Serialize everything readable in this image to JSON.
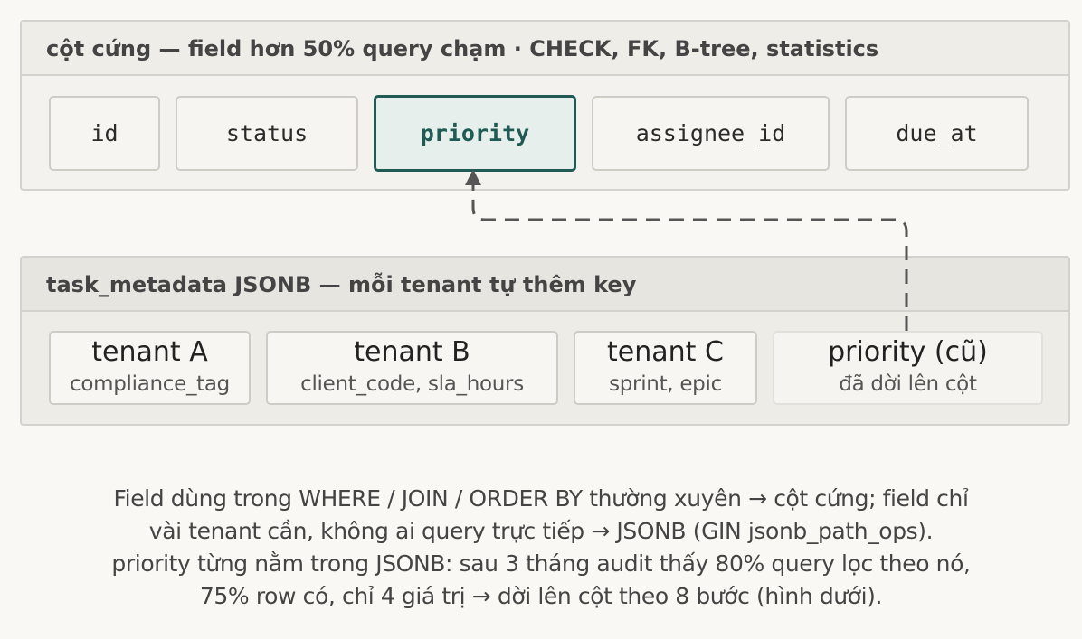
{
  "columns_panel": {
    "title": "cột cứng — field hơn 50% query chạm · CHECK, FK, B-tree, statistics",
    "columns": [
      "id",
      "status",
      "priority",
      "assignee_id",
      "due_at"
    ],
    "highlighted_column": "priority"
  },
  "metadata_panel": {
    "title": "task_metadata JSONB — mỗi tenant tự thêm key",
    "tenants": [
      {
        "name": "tenant A",
        "keys": "compliance_tag"
      },
      {
        "name": "tenant B",
        "keys": "client_code, sla_hours"
      },
      {
        "name": "tenant C",
        "keys": "sprint, epic"
      },
      {
        "name": "priority (cũ)",
        "keys": "đã dời lên cột"
      }
    ]
  },
  "caption": {
    "lines": [
      "Field dùng trong WHERE / JOIN / ORDER BY thường xuyên → cột cứng; field chỉ",
      "vài tenant cần, không ai query trực tiếp → JSONB (GIN jsonb_path_ops).",
      "priority từng nằm trong JSONB: sau 3 tháng audit thấy 80% query lọc theo nó,",
      "75% row có, chỉ 4 giá trị → dời lên cột theo 8 bước (hình dưới)."
    ]
  },
  "colors": {
    "highlight_border": "#1f5a54",
    "highlight_fill": "#e6efec",
    "connector": "#555555",
    "panel_border": "#d4d2cc"
  }
}
